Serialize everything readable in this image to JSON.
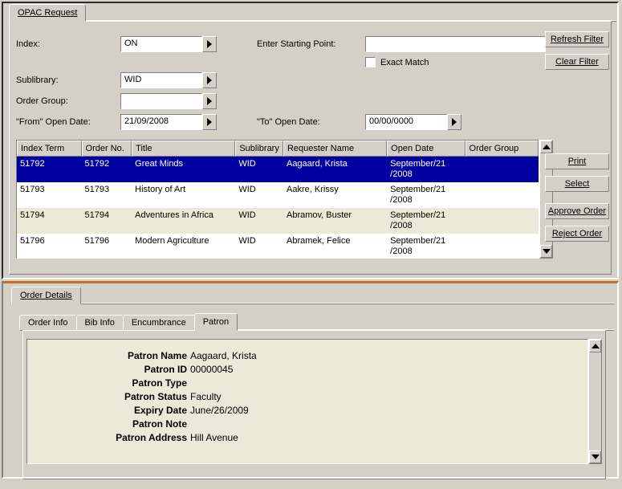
{
  "top_tab": "OPAC Request",
  "labels": {
    "index": "Index:",
    "starting_point": "Enter Starting Point:",
    "exact_match": "Exact Match",
    "sublibrary": "Sublibrary:",
    "order_group": "Order Group:",
    "from_open_date": "\"From\" Open Date:",
    "to_open_date": "\"To\" Open Date:"
  },
  "values": {
    "index": "ON",
    "sublibrary": "WID",
    "order_group": "",
    "from_date": "21/09/2008",
    "to_date": "00/00/0000",
    "starting_point": ""
  },
  "buttons": {
    "refresh": "Refresh Filter",
    "clear": "Clear Filter",
    "print": "Print",
    "select": "Select",
    "approve": "Approve Order",
    "reject": "Reject Order"
  },
  "table": {
    "headers": [
      "Index Term",
      "Order No.",
      "Title",
      "Sublibrary",
      "Requester Name",
      "Open Date",
      "Order Group"
    ],
    "rows": [
      {
        "sel": true,
        "c": [
          "51792",
          "51792",
          "Great Minds",
          "WID",
          "Aagaard, Krista",
          "September/21/2008",
          ""
        ]
      },
      {
        "sel": false,
        "c": [
          "51793",
          "51793",
          "History of Art",
          "WID",
          "Aakre, Krissy",
          "September/21/2008",
          ""
        ]
      },
      {
        "sel": false,
        "c": [
          "51794",
          "51794",
          "Adventures in Africa",
          "WID",
          "Abramov, Buster",
          "September/21/2008",
          ""
        ]
      },
      {
        "sel": false,
        "c": [
          "51796",
          "51796",
          "Modern Agriculture",
          "WID",
          "Abramek, Felice",
          "September/21/2008",
          ""
        ]
      }
    ]
  },
  "details_tab": "Order Details",
  "detail_tabs": [
    "Order Info",
    "Bib Info",
    "Encumbrance",
    "Patron"
  ],
  "patron": {
    "fields": [
      {
        "label": "Patron Name",
        "value": "Aagaard, Krista"
      },
      {
        "label": "Patron ID",
        "value": "00000045"
      },
      {
        "label": "Patron Type",
        "value": ""
      },
      {
        "label": "Patron Status",
        "value": "Faculty"
      },
      {
        "label": "Expiry Date",
        "value": "June/26/2009"
      },
      {
        "label": "Patron Note",
        "value": ""
      },
      {
        "label": "Patron Address",
        "value": "Hill Avenue"
      }
    ]
  }
}
